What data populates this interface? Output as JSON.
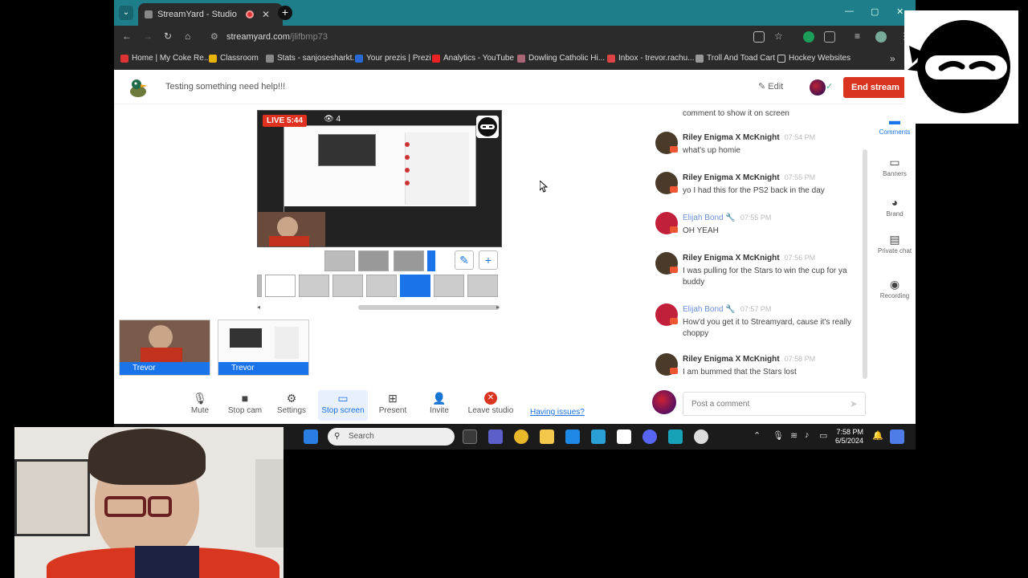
{
  "browser": {
    "tab_title": "StreamYard - Studio",
    "url_domain": "streamyard.com",
    "url_path": "/jlifbmp73",
    "bookmarks": [
      {
        "label": "Home | My Coke Re...",
        "color": "#d33"
      },
      {
        "label": "Classroom",
        "color": "#e8b400"
      },
      {
        "label": "Stats - sanjosesharkt...",
        "color": "#888"
      },
      {
        "label": "Your prezis | Prezi",
        "color": "#2a6ad6"
      },
      {
        "label": "Analytics - YouTube",
        "color": "#e22"
      },
      {
        "label": "Dowling Catholic Hi...",
        "color": "#a67"
      },
      {
        "label": "Inbox - trevor.rachu...",
        "color": "#d44"
      },
      {
        "label": "Troll And Toad Cart",
        "color": "#999"
      },
      {
        "label": "Hockey Websites",
        "color": "#ccc"
      }
    ]
  },
  "studio": {
    "broadcast_title": "Testing something need help!!!",
    "edit_label": "Edit",
    "end_stream_label": "End stream",
    "live_label": "LIVE 5:44",
    "viewer_count": "4",
    "participants": [
      {
        "name": "Trevor",
        "kind": "camera"
      },
      {
        "name": "Trevor",
        "kind": "screen"
      }
    ],
    "toolbar": {
      "mute": "Mute",
      "stop_cam": "Stop cam",
      "settings": "Settings",
      "stop_screen": "Stop screen",
      "present": "Present",
      "invite": "Invite",
      "leave": "Leave studio",
      "having_issues": "Having issues?"
    }
  },
  "comments": {
    "top_line": "comment to show it on screen",
    "items": [
      {
        "name": "Riley Enigma X McKnight",
        "time": "07:54 PM",
        "text": "what's up homie",
        "host": false,
        "avatar_color": "#4a3a2a"
      },
      {
        "name": "Riley Enigma X McKnight",
        "time": "07:55 PM",
        "text": "yo I had this for the PS2 back in the day",
        "host": false,
        "avatar_color": "#4a3a2a"
      },
      {
        "name": "Elijah Bond",
        "time": "07:55 PM",
        "text": "OH YEAH",
        "host": true,
        "avatar_color": "#c2203a"
      },
      {
        "name": "Riley Enigma X McKnight",
        "time": "07:56 PM",
        "text": "I was pulling for the Stars to win the cup for ya buddy",
        "host": false,
        "avatar_color": "#4a3a2a"
      },
      {
        "name": "Elijah Bond",
        "time": "07:57 PM",
        "text": "How'd you get it to Streamyard, cause it's really choppy",
        "host": true,
        "avatar_color": "#c2203a"
      },
      {
        "name": "Riley Enigma X McKnight",
        "time": "07:58 PM",
        "text": "I am bummed that the Stars lost",
        "host": false,
        "avatar_color": "#4a3a2a"
      }
    ],
    "post_placeholder": "Post a comment"
  },
  "side_rail": [
    {
      "label": "Comments",
      "icon": "comment-icon",
      "active": true
    },
    {
      "label": "Banners",
      "icon": "banner-icon",
      "active": false
    },
    {
      "label": "Brand",
      "icon": "palette-icon",
      "active": false
    },
    {
      "label": "Private chat",
      "icon": "chat-icon",
      "active": false
    },
    {
      "label": "Recording",
      "icon": "record-icon",
      "active": false
    }
  ],
  "taskbar": {
    "search_placeholder": "Search",
    "time": "7:58 PM",
    "date": "6/5/2024"
  }
}
